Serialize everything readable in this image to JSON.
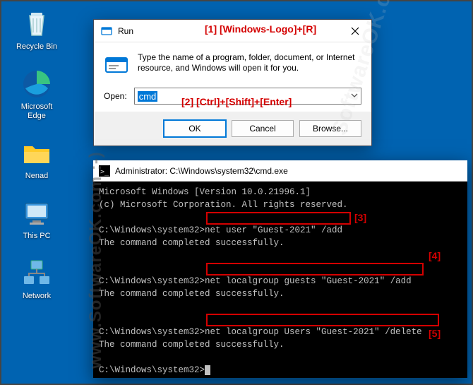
{
  "desktop": {
    "icons": [
      {
        "name": "recycle-bin",
        "label": "Recycle Bin"
      },
      {
        "name": "microsoft-edge",
        "label": "Microsoft\nEdge"
      },
      {
        "name": "nenad",
        "label": "Nenad"
      },
      {
        "name": "this-pc",
        "label": "This PC"
      },
      {
        "name": "network",
        "label": "Network"
      }
    ]
  },
  "run": {
    "title": "Run",
    "description": "Type the name of a program, folder, document, or Internet resource, and Windows will open it for you.",
    "open_label": "Open:",
    "input_value": "cmd",
    "buttons": {
      "ok": "OK",
      "cancel": "Cancel",
      "browse": "Browse..."
    }
  },
  "annotations": {
    "a1": "[1]   [Windows-Logo]+[R]",
    "a2": "[2]      [Ctrl]+[Shift]+[Enter]",
    "a3": "[3]",
    "a4": "[4]",
    "a5": "[5]"
  },
  "terminal": {
    "title": "Administrator: C:\\Windows\\system32\\cmd.exe",
    "lines": {
      "l1": "Microsoft Windows [Version 10.0.21996.1]",
      "l2": "(c) Microsoft Corporation. All rights reserved.",
      "blank": "",
      "p1": "C:\\Windows\\system32>",
      "c1": "net user \"Guest-2021\" /add",
      "r1": "The command completed successfully.",
      "c2": "net localgroup guests \"Guest-2021\" /add",
      "c3": "net localgroup Users \"Guest-2021\" /delete"
    }
  },
  "watermark": "www.SoftwareOK.com :-)",
  "watermark2": "SoftwareOK.com"
}
